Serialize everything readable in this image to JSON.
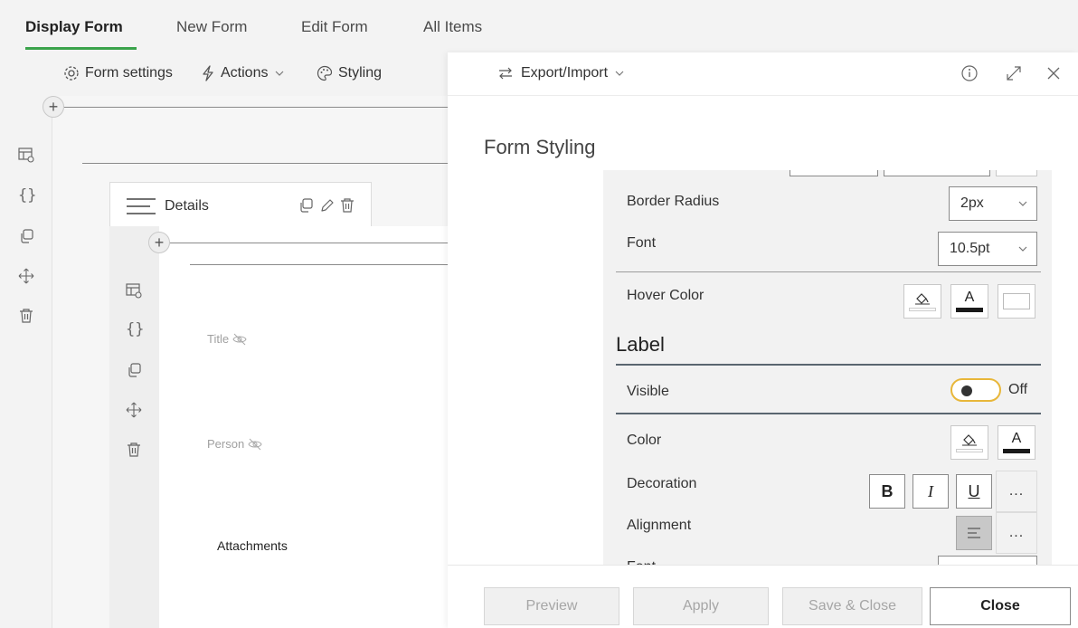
{
  "tabs": [
    {
      "label": "Display Form",
      "active": true
    },
    {
      "label": "New Form"
    },
    {
      "label": "Edit Form"
    },
    {
      "label": "All Items"
    }
  ],
  "toolbar": {
    "form_settings": "Form settings",
    "actions": "Actions",
    "styling": "Styling"
  },
  "canvas": {
    "details_label": "Details",
    "fields": {
      "title": "Title",
      "person": "Person",
      "attachments": "Attachments"
    }
  },
  "panel": {
    "export_import": "Export/Import",
    "title": "Form Styling",
    "border_radius": {
      "label": "Border Radius",
      "value": "2px"
    },
    "font": {
      "label": "Font",
      "value": "10.5pt"
    },
    "hover_color": {
      "label": "Hover Color",
      "text_glyph": "A"
    },
    "label_section": "Label",
    "visible": {
      "label": "Visible",
      "state": "Off"
    },
    "color": {
      "label": "Color",
      "text_glyph": "A"
    },
    "decoration": {
      "label": "Decoration",
      "bold": "B",
      "italic": "I",
      "underline": "U",
      "more": "..."
    },
    "alignment": {
      "label": "Alignment",
      "more": "..."
    },
    "partial_next": "Font"
  },
  "footer": {
    "preview": "Preview",
    "apply": "Apply",
    "save_close": "Save & Close",
    "close": "Close"
  },
  "colors": {
    "accent": "#3aa34b",
    "toggle_border": "#e8b73a"
  }
}
